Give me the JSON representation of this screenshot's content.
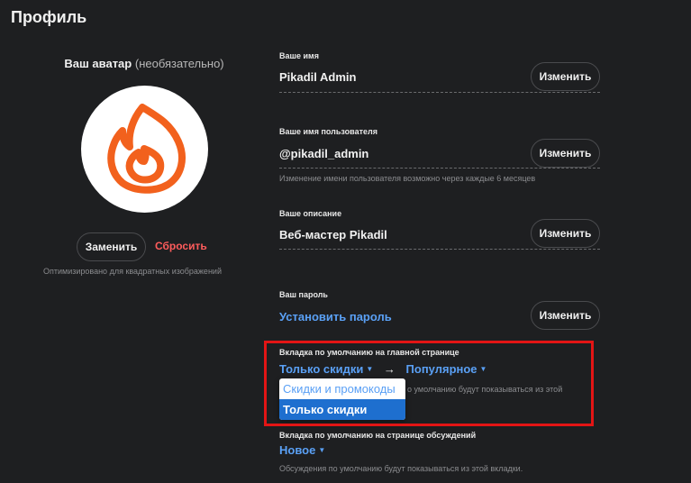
{
  "page": {
    "title": "Профиль"
  },
  "avatar": {
    "label": "Ваш аватар",
    "optional": "(необязательно)",
    "replace_label": "Заменить",
    "reset_label": "Сбросить",
    "hint": "Оптимизировано для квадратных изображений",
    "icon": "flame-logo-icon"
  },
  "fields": {
    "name": {
      "label": "Ваше имя",
      "value": "Pikadil Admin",
      "button": "Изменить"
    },
    "username": {
      "label": "Ваше имя пользователя",
      "value": "@pikadil_admin",
      "button": "Изменить",
      "hint": "Изменение имени пользователя возможно через каждые 6 месяцев"
    },
    "description": {
      "label": "Ваше описание",
      "value": "Веб-мастер Pikadil",
      "button": "Изменить"
    },
    "password": {
      "label": "Ваш пароль",
      "value": "Установить пароль",
      "button": "Изменить"
    }
  },
  "home_tab": {
    "label": "Вкладка по умолчанию на главной странице",
    "selected": "Только скидки",
    "arrow": "→",
    "target": "Популярное",
    "hint_partial": "о умолчанию будут показываться из этой",
    "dropdown_options": [
      "Скидки и промокоды",
      "Только скидки"
    ],
    "dropdown_selected": "Только скидки"
  },
  "discussion_tab": {
    "label": "Вкладка по умолчанию на странице обсуждений",
    "selected": "Новое",
    "hint": "Обсуждения по умолчанию будут показываться из этой вкладки."
  },
  "colors": {
    "accent": "#5aa0f5",
    "danger": "#ff5c5c",
    "highlight": "#e31515",
    "brand": "#f2611d"
  }
}
